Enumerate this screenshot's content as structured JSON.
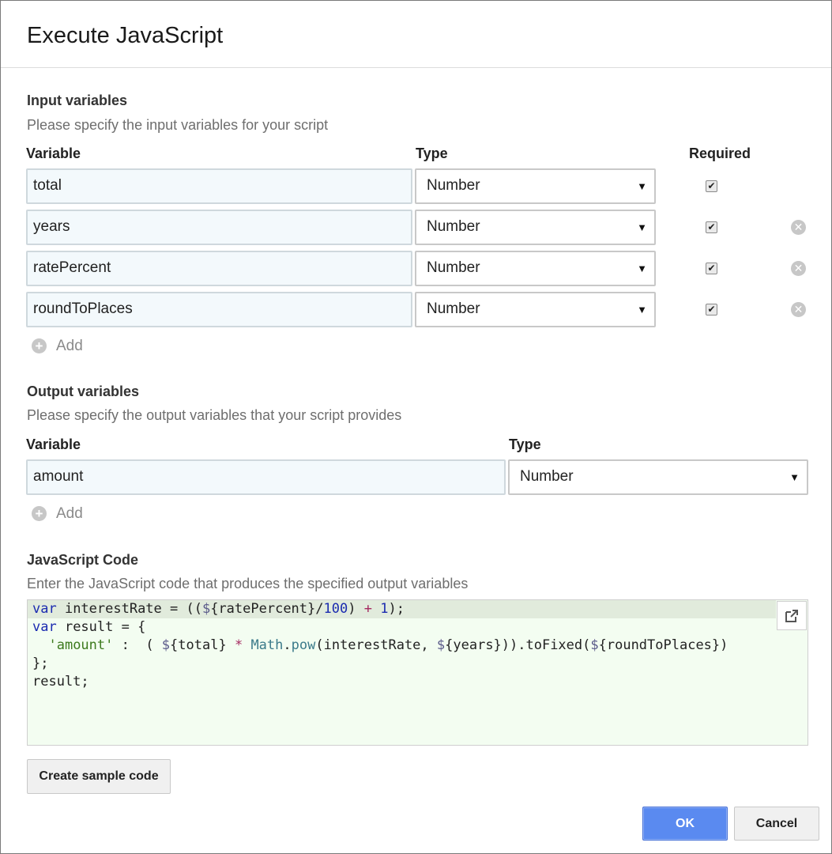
{
  "dialog": {
    "title": "Execute JavaScript"
  },
  "input_section": {
    "title": "Input variables",
    "description": "Please specify the input variables for your script",
    "col_variable": "Variable",
    "col_type": "Type",
    "col_required": "Required",
    "rows": [
      {
        "variable": "total",
        "type": "Number",
        "required": true,
        "removable": false
      },
      {
        "variable": "years",
        "type": "Number",
        "required": true,
        "removable": true
      },
      {
        "variable": "ratePercent",
        "type": "Number",
        "required": true,
        "removable": true
      },
      {
        "variable": "roundToPlaces",
        "type": "Number",
        "required": true,
        "removable": true
      }
    ],
    "add_label": "Add"
  },
  "output_section": {
    "title": "Output variables",
    "description": "Please specify the output variables that your script provides",
    "col_variable": "Variable",
    "col_type": "Type",
    "rows": [
      {
        "variable": "amount",
        "type": "Number"
      }
    ],
    "add_label": "Add"
  },
  "code_section": {
    "title": "JavaScript Code",
    "description": "Enter the JavaScript code that produces the specified output variables",
    "lines": [
      "var interestRate = ((${ratePercent}/100) + 1);",
      "var result = {",
      "  'amount' :  ( ${total} * Math.pow(interestRate, ${years})).toFixed(${roundToPlaces})",
      "};",
      "result;"
    ]
  },
  "buttons": {
    "sample": "Create sample code",
    "ok": "OK",
    "cancel": "Cancel"
  },
  "icons": {
    "select_arrow": "▼",
    "checkmark": "✔",
    "remove": "✕",
    "add": "+",
    "expand": "⧉"
  }
}
